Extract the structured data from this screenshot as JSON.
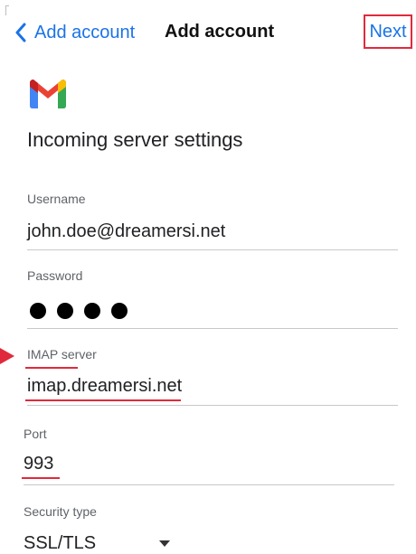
{
  "header": {
    "back_label": "Add account",
    "title": "Add account",
    "next_label": "Next"
  },
  "section_title": "Incoming server settings",
  "fields": {
    "username": {
      "label": "Username",
      "value": "john.doe@dreamersi.net"
    },
    "password": {
      "label": "Password",
      "masked_length": 4
    },
    "imap_server": {
      "label": "IMAP server",
      "value": "imap.dreamersi.net"
    },
    "port": {
      "label": "Port",
      "value": "993"
    },
    "security_type": {
      "label": "Security type",
      "value": "SSL/TLS"
    }
  },
  "colors": {
    "accent": "#1a73e8",
    "annotation": "#e02a3b"
  },
  "icons": {
    "back": "chevron-left-icon",
    "logo": "gmail-logo-icon",
    "select": "caret-down-icon",
    "marker": "arrow-right-icon"
  }
}
